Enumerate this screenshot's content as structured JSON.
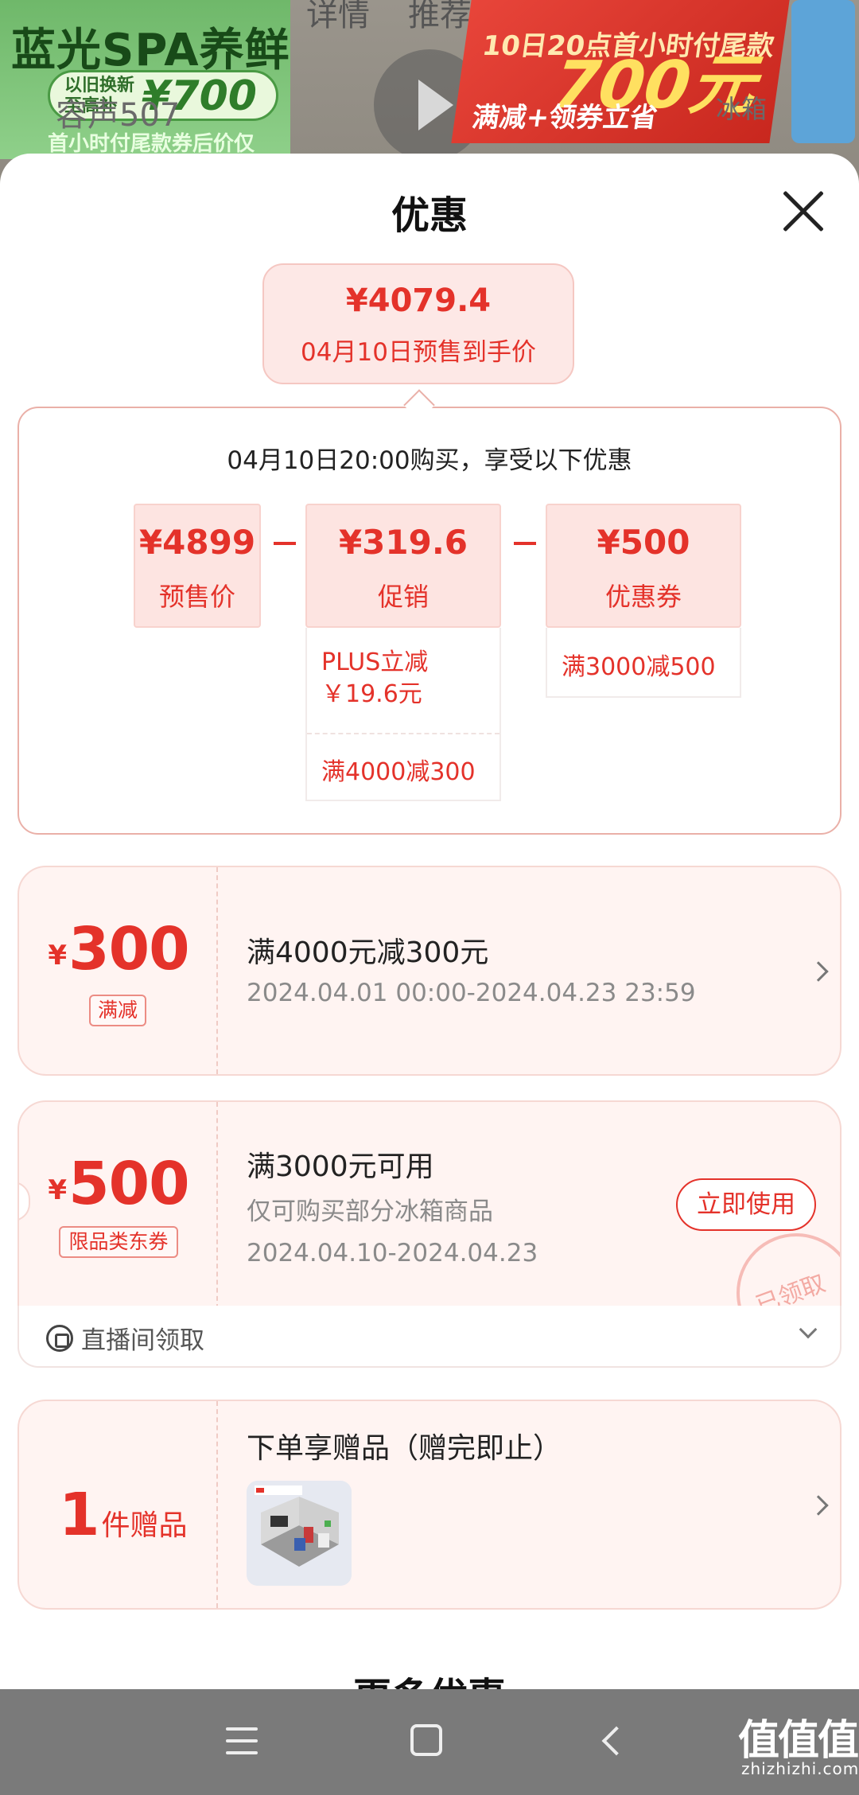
{
  "background": {
    "promo_left_title": "蓝光SPA养鲜",
    "promo_left_pill_line1": "以旧换新",
    "promo_left_pill_line2": "至高补",
    "promo_left_pill_amount": "¥700",
    "promo_left_footer": "首小时付尾款券后价仅",
    "tabs": [
      "详情",
      "推荐"
    ],
    "promo_right_line1": "10日20点首小时付尾款",
    "promo_right_amount": "700元",
    "promo_right_line2": "满减+领券立省",
    "search_text": "容声507",
    "category_text": "冰箱"
  },
  "sheet": {
    "title": "优惠",
    "final": {
      "price": "¥4079.4",
      "subtitle": "04月10日预售到手价"
    },
    "calc": {
      "intro": "04月10日20:00购买，享受以下优惠",
      "items": [
        {
          "value": "¥4899",
          "label": "预售价"
        },
        {
          "value": "¥319.6",
          "label": "促销"
        },
        {
          "value": "¥500",
          "label": "优惠券"
        }
      ],
      "promo_details": [
        "PLUS立减",
        "￥19.6元",
        "满4000减300"
      ],
      "coupon_details": [
        "满3000减500"
      ]
    },
    "coupons": [
      {
        "currency": "¥",
        "amount": "300",
        "tag": "满减",
        "title": "满4000元减300元",
        "dates": "2024.04.01 00:00-2024.04.23 23:59"
      },
      {
        "currency": "¥",
        "amount": "500",
        "tag": "限品类东券",
        "title": "满3000元可用",
        "scope": "仅可购买部分冰箱商品",
        "dates": "2024.04.10-2024.04.23",
        "button": "立即使用",
        "stamp": "已领取",
        "source": "直播间领取"
      }
    ],
    "gift": {
      "count": "1",
      "unit": "件赠品",
      "title": "下单享赠品（赠完即止）"
    },
    "more_title": "更多优惠"
  },
  "watermark": {
    "text": "值值值",
    "url": "zhizhizhi.com"
  },
  "colors": {
    "accent": "#e4322a",
    "card_bg": "#fff4f2",
    "navbar": "#7a7a7a"
  }
}
